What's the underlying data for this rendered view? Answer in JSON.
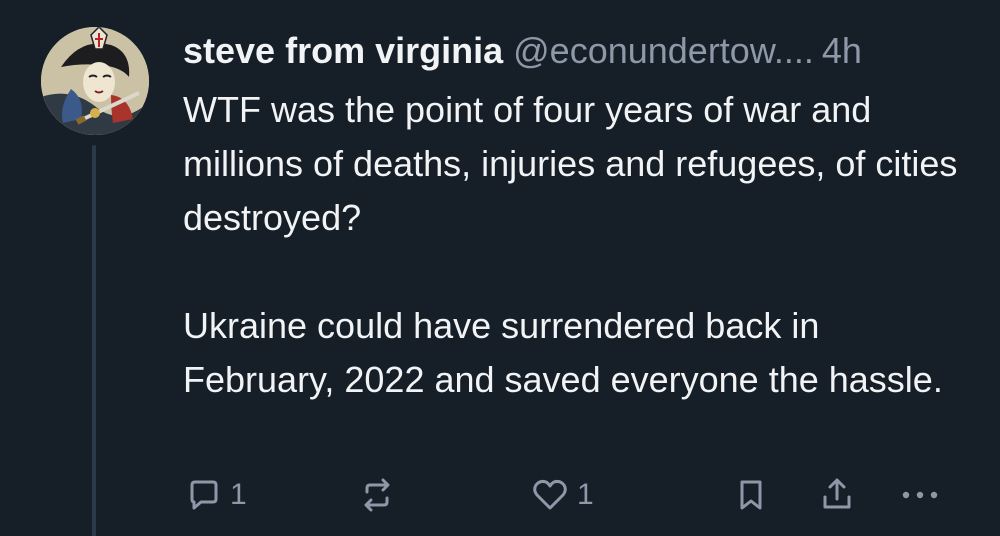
{
  "post": {
    "author": {
      "display_name": "steve from virginia",
      "handle": "@econundertow....",
      "avatar_icon": "ukiyo-e-samurai-avatar"
    },
    "time_ago": "4h",
    "paragraphs": [
      "WTF was the point of four years of war and millions of deaths, injuries and refugees, of cities destroyed?",
      "Ukraine could have surrendered back in February, 2022 and saved everyone the hassle."
    ],
    "actions": {
      "reply": {
        "icon": "reply-bubble-icon",
        "count": "1"
      },
      "repost": {
        "icon": "repost-icon"
      },
      "like": {
        "icon": "heart-icon",
        "count": "1"
      },
      "bookmark": {
        "icon": "bookmark-icon"
      },
      "share": {
        "icon": "share-icon"
      },
      "more": {
        "icon": "more-horizontal-icon"
      }
    }
  },
  "colors": {
    "background": "#161e27",
    "text": "#f1f3f5",
    "muted": "#8d99a8",
    "thread_line": "#2b3a4a"
  }
}
